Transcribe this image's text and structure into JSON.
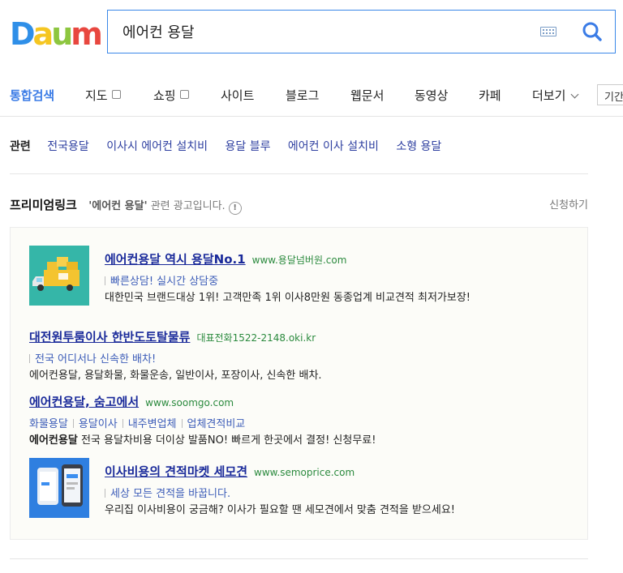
{
  "logo": {
    "text": [
      "D",
      "a",
      "u",
      "m"
    ],
    "colors": [
      "#2f8fe8",
      "#f5c622",
      "#8dc63f",
      "#e8473f"
    ]
  },
  "search": {
    "query": "에어컨 용달"
  },
  "tabs": [
    {
      "label": "통합검색",
      "active": true
    },
    {
      "label": "지도",
      "box": true
    },
    {
      "label": "쇼핑",
      "box": true
    },
    {
      "label": "사이트"
    },
    {
      "label": "블로그"
    },
    {
      "label": "웹문서"
    },
    {
      "label": "동영상"
    },
    {
      "label": "카페"
    },
    {
      "label": "더보기",
      "dropdown": true
    }
  ],
  "period_button": "기간",
  "related": {
    "label": "관련",
    "items": [
      "전국용달",
      "이사시 에어컨 설치비",
      "용달 블루",
      "에어컨 이사 설치비",
      "소형 용달"
    ]
  },
  "premium": {
    "title": "프리미엄링크",
    "query_quote": "'에어컨 용달'",
    "desc_suffix": " 관련 광고입니다.",
    "apply": "신청하기"
  },
  "ads": [
    {
      "title": "에어컨용달 역시 용달No.1",
      "url": "www.용달넘버원.com",
      "sub": "빠른상담! 실시간 상담중",
      "body": "대한민국 브랜드대상 1위! 고객만족 1위 이사8만원 동종업계 비교견적 최저가보장!",
      "thumb": "truck-icon"
    },
    {
      "title": "대전원투룸이사 한반도토탈물류",
      "url": "대표전화1522-2148.oki.kr",
      "sub": "전국 어디서나 신속한 배차!",
      "body": "에어컨용달, 용달화물, 화물운송, 일반이사, 포장이사, 신속한 배차."
    },
    {
      "title": "에어컨용달, 숨고에서",
      "url": "www.soomgo.com",
      "links": [
        "화물용달",
        "용달이사",
        "내주변업체",
        "업체견적비교"
      ],
      "body_bold": "에어컨용달",
      "body": " 전국 용달차비용 더이상 발품NO! 빠르게 한곳에서 결정! 신청무료!"
    },
    {
      "title": "이사비용의 견적마켓 세모견",
      "url": "www.semoprice.com",
      "sub": "세상 모든 견적을 바꿉니다.",
      "body": "우리집 이사비용이 궁금해? 이사가 필요할 땐 세모견에서 맞춤 견적을 받으세요!",
      "thumb": "phone-app-icon"
    }
  ]
}
